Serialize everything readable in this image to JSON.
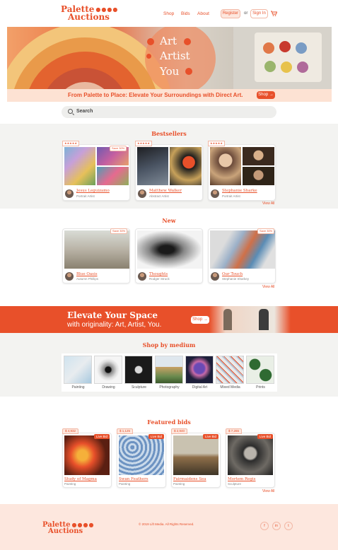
{
  "header": {
    "logo_line1": "Palette",
    "logo_line2": "Auctions",
    "logo_dots": "●●●●",
    "nav": [
      "Shop",
      "Bids",
      "About"
    ],
    "register": "Register",
    "or": "or",
    "signin": "Sign In"
  },
  "hero": {
    "lines": [
      "Art",
      "Artist",
      "You"
    ]
  },
  "promo": {
    "text": "From Palette to Place: Elevate Your Surroundings with Direct Art.",
    "shop": "Shop"
  },
  "search": {
    "placeholder": "Search"
  },
  "bestsellers": {
    "title": "Bestsellers",
    "view_all": "View All",
    "stars": "★★★★★",
    "save": "Save 30%",
    "items": [
      {
        "name": "Jesus Leguizamo",
        "role": "Portrait Artist"
      },
      {
        "name": "Matthew Walker",
        "role": "Abstract Artist"
      },
      {
        "name": "Stephanie Sharke",
        "role": "Portrait Artist"
      }
    ]
  },
  "new": {
    "title": "New",
    "view_all": "View All",
    "save": "Save 30%",
    "items": [
      {
        "title": "Blue Oasis",
        "artist": "Autumn Phillips"
      },
      {
        "title": "Thoughts",
        "artist": "Rodger Struck"
      },
      {
        "title": "Our Touch",
        "artist": "Stephanie Sharkey"
      }
    ]
  },
  "banner": {
    "title": "Elevate Your Space",
    "subtitle": "with originality: Art, Artist, You.",
    "shop": "Shop"
  },
  "mediums": {
    "title": "Shop by medium",
    "items": [
      "Painting",
      "Drawing",
      "Sculpture",
      "Photography",
      "Digital Art",
      "Mixed Media",
      "Prints"
    ]
  },
  "featured": {
    "title": "Featured bids",
    "view_all": "View All",
    "live": "Live Bid",
    "items": [
      {
        "price": "$ 4,932",
        "title": "Study of Magma",
        "type": "Painting"
      },
      {
        "price": "$ 1,125",
        "title": "Swan Feathers",
        "type": "Painting"
      },
      {
        "price": "$ 2,940",
        "title": "Fairmaidens Sea",
        "type": "Painting"
      },
      {
        "price": "$ 7,265",
        "title": "Mortem Regis",
        "type": "Sculpture"
      }
    ]
  },
  "footer": {
    "copyright": "© 2019 Lift Media. All Rights Reserved.",
    "social": [
      "f",
      "in",
      "t"
    ]
  },
  "colors": {
    "accent": "#e8502a",
    "soft": "#fde7de",
    "section": "#f3f3f1"
  }
}
